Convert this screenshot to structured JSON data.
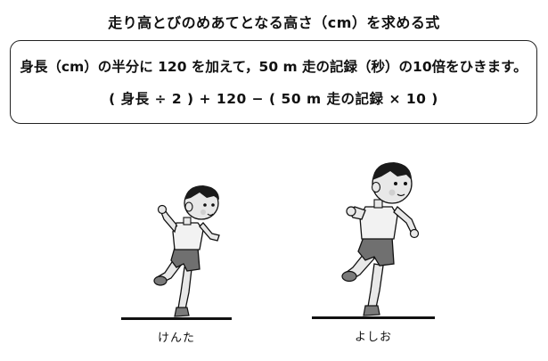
{
  "title": "走り高とびのめあてとなる高さ（cm）を求める式",
  "formula": {
    "description": "身長（cm）の半分に 120 を加えて，50 m 走の記録（秒）の10倍をひきます。",
    "expression": "( 身長 ÷ 2 ) + 120 − ( 50 m 走の記録 × 10 )"
  },
  "children": [
    {
      "name": "けんた"
    },
    {
      "name": "よしお"
    }
  ],
  "colors": {
    "text": "#111111",
    "skin": "#e8e8e8",
    "hair": "#1a1a1a",
    "shirt": "#f2f2f2",
    "shorts": "#707070",
    "shoes": "#7a7a7a",
    "ground": "#111111"
  }
}
